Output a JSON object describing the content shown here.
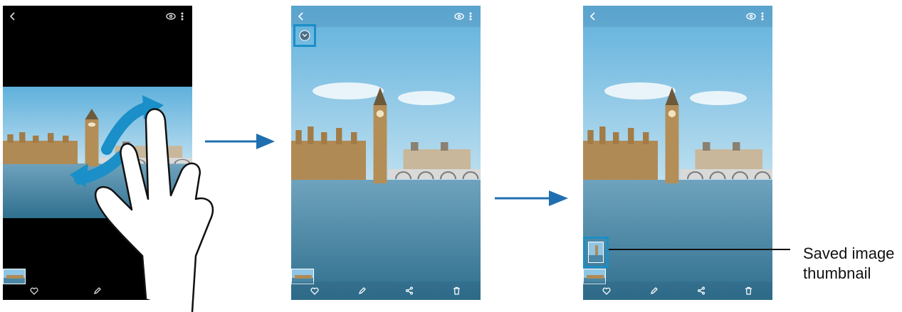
{
  "step1": {
    "icons": [
      "back-icon",
      "view-icon",
      "more-icon",
      "heart-icon",
      "edit-icon",
      "share-icon"
    ]
  },
  "step2": {
    "icons": [
      "back-icon",
      "view-icon",
      "more-icon",
      "heart-icon",
      "edit-icon",
      "share-icon",
      "trash-icon"
    ]
  },
  "step3": {
    "icons": [
      "back-icon",
      "view-icon",
      "more-icon",
      "heart-icon",
      "edit-icon",
      "share-icon",
      "trash-icon"
    ]
  },
  "callout": {
    "label": "Saved image thumbnail"
  },
  "colors": {
    "accent": "#1a8fc8",
    "arrow": "#1f6fb0",
    "sky": "#8fc6e6",
    "water": "#4a87a6",
    "dark": "#000000"
  }
}
